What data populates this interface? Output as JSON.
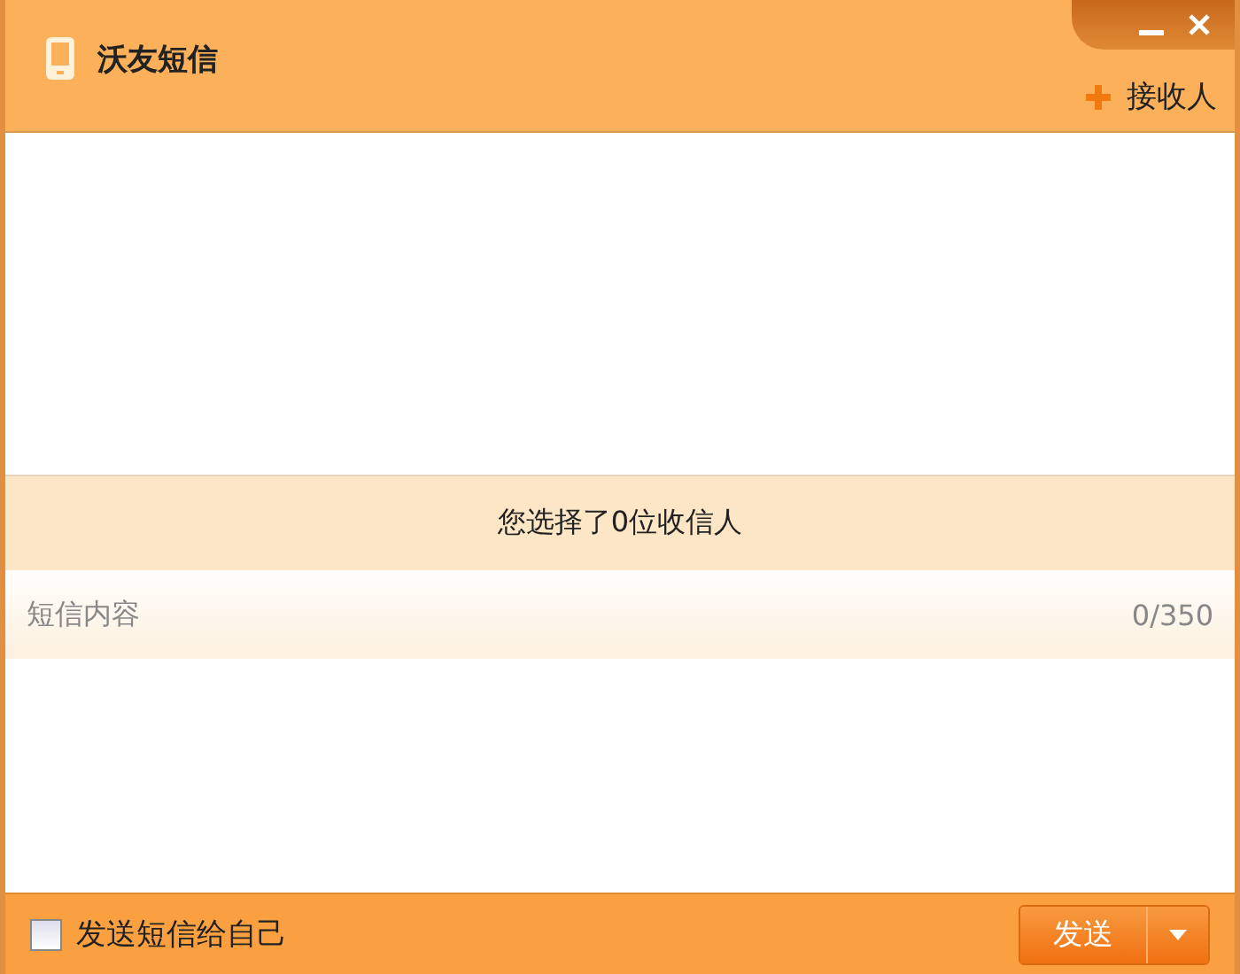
{
  "window": {
    "title": "沃友短信"
  },
  "add_recipient": {
    "label": "接收人"
  },
  "summary": "您选择了0位收信人",
  "message": {
    "label": "短信内容",
    "counter": "0/350"
  },
  "footer": {
    "send_to_self": {
      "label": "发送短信给自己",
      "checked": false
    },
    "send_button": "发送"
  }
}
